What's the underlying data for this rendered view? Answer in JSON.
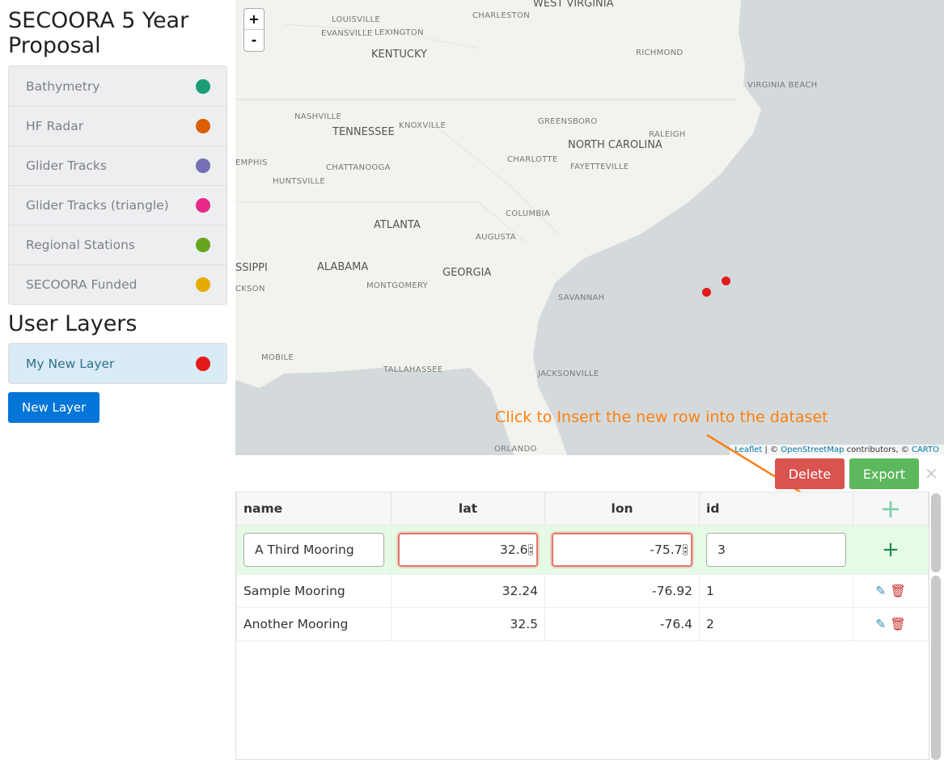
{
  "sidebar": {
    "title": "SECOORA 5 Year Proposal",
    "layers": [
      {
        "label": "Bathymetry",
        "color": "#1b9e77"
      },
      {
        "label": "HF Radar",
        "color": "#d95f02"
      },
      {
        "label": "Glider Tracks",
        "color": "#7570b3"
      },
      {
        "label": "Glider Tracks (triangle)",
        "color": "#e7298a"
      },
      {
        "label": "Regional Stations",
        "color": "#66a61e"
      },
      {
        "label": "SECOORA Funded",
        "color": "#e6ab02"
      }
    ],
    "user_title": "User Layers",
    "user_layers": [
      {
        "label": "My New Layer",
        "color": "#e31a1c"
      }
    ],
    "new_layer": "New Layer"
  },
  "map": {
    "zoom_in": "+",
    "zoom_out": "-",
    "states": [
      "WEST VIRGINIA",
      "KENTUCKY",
      "TENNESSEE",
      "NORTH CAROLINA",
      "ATLANTA",
      "ALABAMA",
      "GEORGIA",
      "SSIPPI"
    ],
    "places": [
      "LOUISVILLE",
      "CHARLESTON",
      "EVANSVILLE",
      "LEXINGTON",
      "RICHMOND",
      "VIRGINIA BEACH",
      "NASHVILLE",
      "KNOXVILLE",
      "GREENSBORO",
      "RALEIGH",
      "EMPHIS",
      "CHARLOTTE",
      "FAYETTEVILLE",
      "CHATTANOOGA",
      "HUNTSVILLE",
      "COLUMBIA",
      "AUGUSTA",
      "MONTGOMERY",
      "CKSON",
      "SAVANNAH",
      "MOBILE",
      "TALLAHASSEE",
      "JACKSONVILLE",
      "ORLANDO"
    ],
    "attribution": {
      "leaflet": "Leaflet",
      "sep": " | © ",
      "osm": "OpenStreetMap",
      "mid": " contributors, © ",
      "carto": "CARTO"
    }
  },
  "annotation": "Click to Insert the new row into the dataset",
  "toolbar": {
    "delete": "Delete",
    "export": "Export",
    "close": "✕"
  },
  "table": {
    "headers": [
      "name",
      "lat",
      "lon",
      "id"
    ],
    "new_row": {
      "name": "A Third Mooring",
      "lat": "32.6",
      "lon": "-75.7",
      "id": "3"
    },
    "rows": [
      {
        "name": "Sample Mooring",
        "lat": "32.24",
        "lon": "-76.92",
        "id": "1"
      },
      {
        "name": "Another Mooring",
        "lat": "32.5",
        "lon": "-76.4",
        "id": "2"
      }
    ]
  },
  "colors": {
    "accent": "#0275d8",
    "delete": "#d9534f",
    "export": "#5cb85c",
    "annotation": "#ff7f0e"
  }
}
